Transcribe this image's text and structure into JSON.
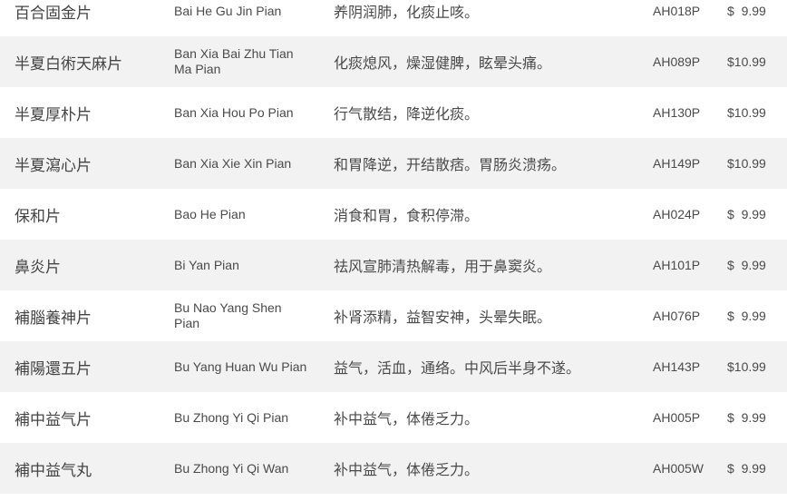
{
  "products": [
    {
      "name": "百合固金片",
      "pinyin": "Bai He Gu Jin Pian",
      "description": "养阴润肺，化痰止咳。",
      "code": "AH018P",
      "price": "$  9.99"
    },
    {
      "name": "半夏白術天麻片",
      "pinyin": "Ban Xia Bai Zhu Tian Ma Pian",
      "description": "化痰熄风，燥湿健脾，眩晕头痛。",
      "code": "AH089P",
      "price": "$10.99"
    },
    {
      "name": "半夏厚朴片",
      "pinyin": "Ban Xia Hou Po Pian",
      "description": "行气散结，降逆化痰。",
      "code": "AH130P",
      "price": "$10.99"
    },
    {
      "name": "半夏瀉心片",
      "pinyin": "Ban Xia Xie Xin Pian",
      "description": "和胃降逆，开结散痞。胃肠炎溃疡。",
      "code": "AH149P",
      "price": "$10.99"
    },
    {
      "name": "保和片",
      "pinyin": "Bao He Pian",
      "description": "消食和胃，食积停滞。",
      "code": "AH024P",
      "price": "$  9.99"
    },
    {
      "name": "鼻炎片",
      "pinyin": "Bi Yan Pian",
      "description": "祛风宣肺清热解毒，用于鼻窦炎。",
      "code": "AH101P",
      "price": "$  9.99"
    },
    {
      "name": "補腦養神片",
      "pinyin": "Bu Nao Yang Shen Pian",
      "description": "补肾添精，益智安神，头晕失眠。",
      "code": "AH076P",
      "price": "$  9.99"
    },
    {
      "name": "補陽還五片",
      "pinyin": "Bu Yang Huan Wu Pian",
      "description": "益气，活血，通络。中风后半身不遂。",
      "code": "AH143P",
      "price": "$10.99"
    },
    {
      "name": "補中益气片",
      "pinyin": "Bu Zhong Yi Qi Pian",
      "description": "补中益气，体倦乏力。",
      "code": "AH005P",
      "price": "$  9.99"
    },
    {
      "name": "補中益气丸",
      "pinyin": "Bu Zhong Yi Qi Wan",
      "description": "补中益气，体倦乏力。",
      "code": "AH005W",
      "price": "$  9.99"
    }
  ]
}
